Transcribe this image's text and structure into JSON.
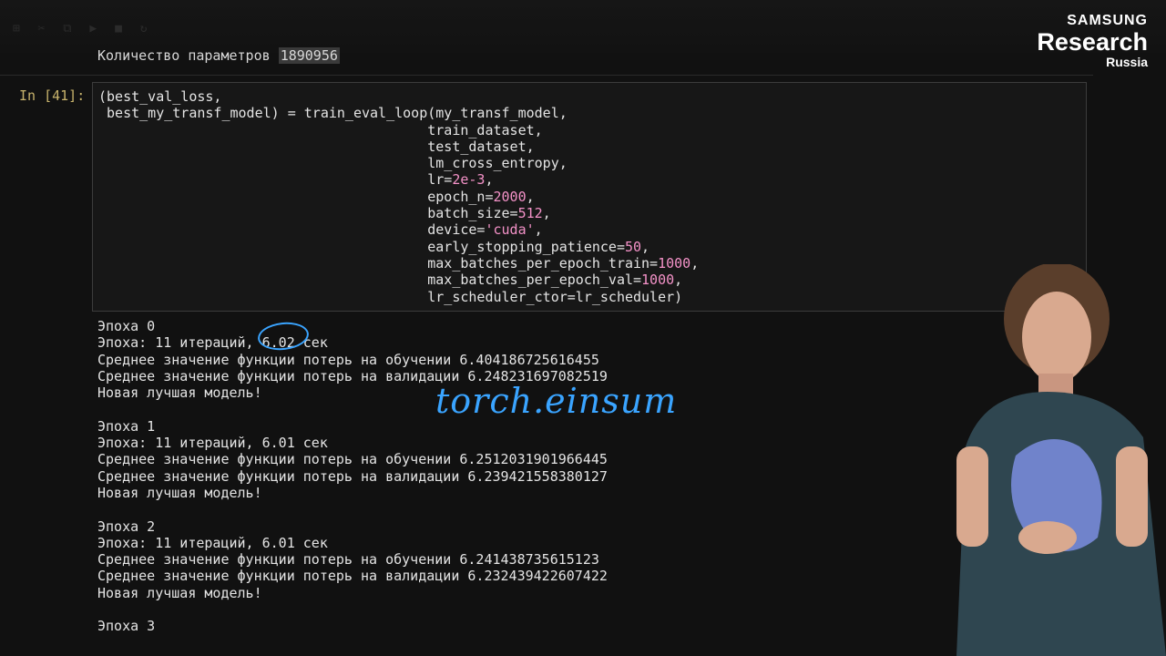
{
  "logo": {
    "line1": "SAMSUNG",
    "line2": "Research",
    "line3": "Russia"
  },
  "prev_output": {
    "label": "Количество параметров",
    "value": "1890956"
  },
  "cell": {
    "prompt": "In [41]:",
    "lines": [
      "(best_val_loss,",
      " best_my_transf_model) = train_eval_loop(my_transf_model,",
      "                                        train_dataset,",
      "                                        test_dataset,",
      "                                        lm_cross_entropy,",
      "                                        lr=2e-3,",
      "                                        epoch_n=2000,",
      "                                        batch_size=512,",
      "                                        device='cuda',",
      "                                        early_stopping_patience=50,",
      "                                        max_batches_per_epoch_train=1000,",
      "                                        max_batches_per_epoch_val=1000,",
      "                                        lr_scheduler_ctor=lr_scheduler)"
    ]
  },
  "output": {
    "lines": [
      "Эпоха 0",
      "Эпоха: 11 итераций, 6.02 сек",
      "Среднее значение функции потерь на обучении 6.404186725616455",
      "Среднее значение функции потерь на валидации 6.248231697082519",
      "Новая лучшая модель!",
      "",
      "Эпоха 1",
      "Эпоха: 11 итераций, 6.01 сек",
      "Среднее значение функции потерь на обучении 6.2512031901966445",
      "Среднее значение функции потерь на валидации 6.239421558380127",
      "Новая лучшая модель!",
      "",
      "Эпоха 2",
      "Эпоха: 11 итераций, 6.01 сек",
      "Среднее значение функции потерь на обучении 6.241438735615123",
      "Среднее значение функции потерь на валидации 6.232439422607422",
      "Новая лучшая модель!",
      "",
      "Эпоха 3"
    ]
  },
  "annotation": {
    "handwritten": "torch.einsum"
  },
  "colors": {
    "accent": "#3aa4ff",
    "number": "#f492c8",
    "prompt": "#c8b36c"
  }
}
